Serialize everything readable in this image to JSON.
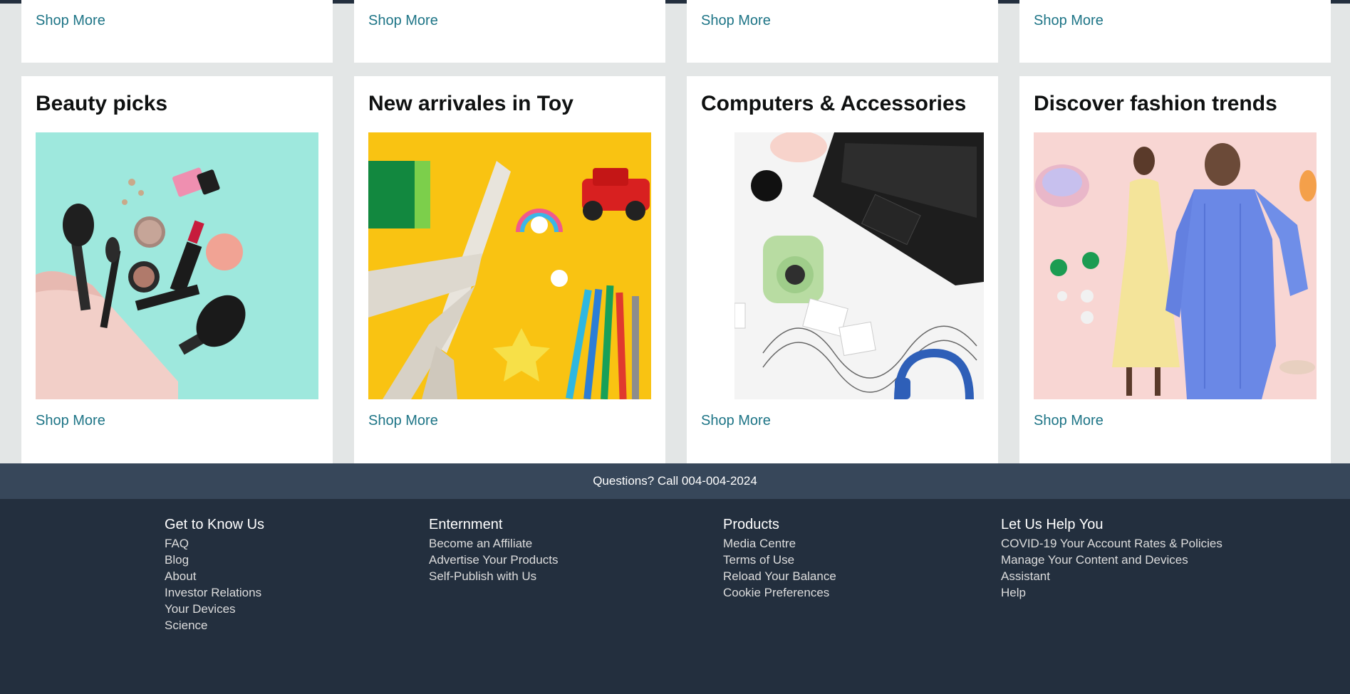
{
  "top_cards": [
    {
      "link": "Shop More"
    },
    {
      "link": "Shop More"
    },
    {
      "link": "Shop More"
    },
    {
      "link": "Shop More"
    }
  ],
  "cards": [
    {
      "title": "Beauty picks",
      "link": "Shop More",
      "image": "makeup-products-photo"
    },
    {
      "title": "New arrivales in Toy",
      "link": "Shop More",
      "image": "toy-airplane-and-car-photo"
    },
    {
      "title": "Computers & Accessories",
      "link": "Shop More",
      "image": "laptop-camera-headphones-photo"
    },
    {
      "title": "Discover fashion trends",
      "link": "Shop More",
      "image": "fashion-models-photo"
    }
  ],
  "contact": {
    "text": "Questions? Call 004-004-2024"
  },
  "footer": {
    "columns": [
      {
        "heading": "Get to Know Us",
        "links": [
          "FAQ",
          "Blog",
          "About",
          "Investor Relations",
          "Your Devices",
          "Science"
        ]
      },
      {
        "heading": "Enternment",
        "links": [
          "Become an Affiliate",
          "Advertise Your Products",
          "Self-Publish with Us"
        ]
      },
      {
        "heading": "Products",
        "links": [
          "Media Centre",
          "Terms of Use",
          "Reload Your Balance",
          "Cookie Preferences"
        ]
      },
      {
        "heading": "Let Us Help You",
        "links": [
          "COVID-19 Your Account Rates & Policies",
          "Manage Your Content and Devices",
          "Assistant",
          "Help"
        ]
      }
    ]
  },
  "colors": {
    "link": "#1d7486",
    "footer_bg": "#232f3e",
    "contact_bg": "#37475a",
    "page_bg": "#e3e6e6"
  }
}
